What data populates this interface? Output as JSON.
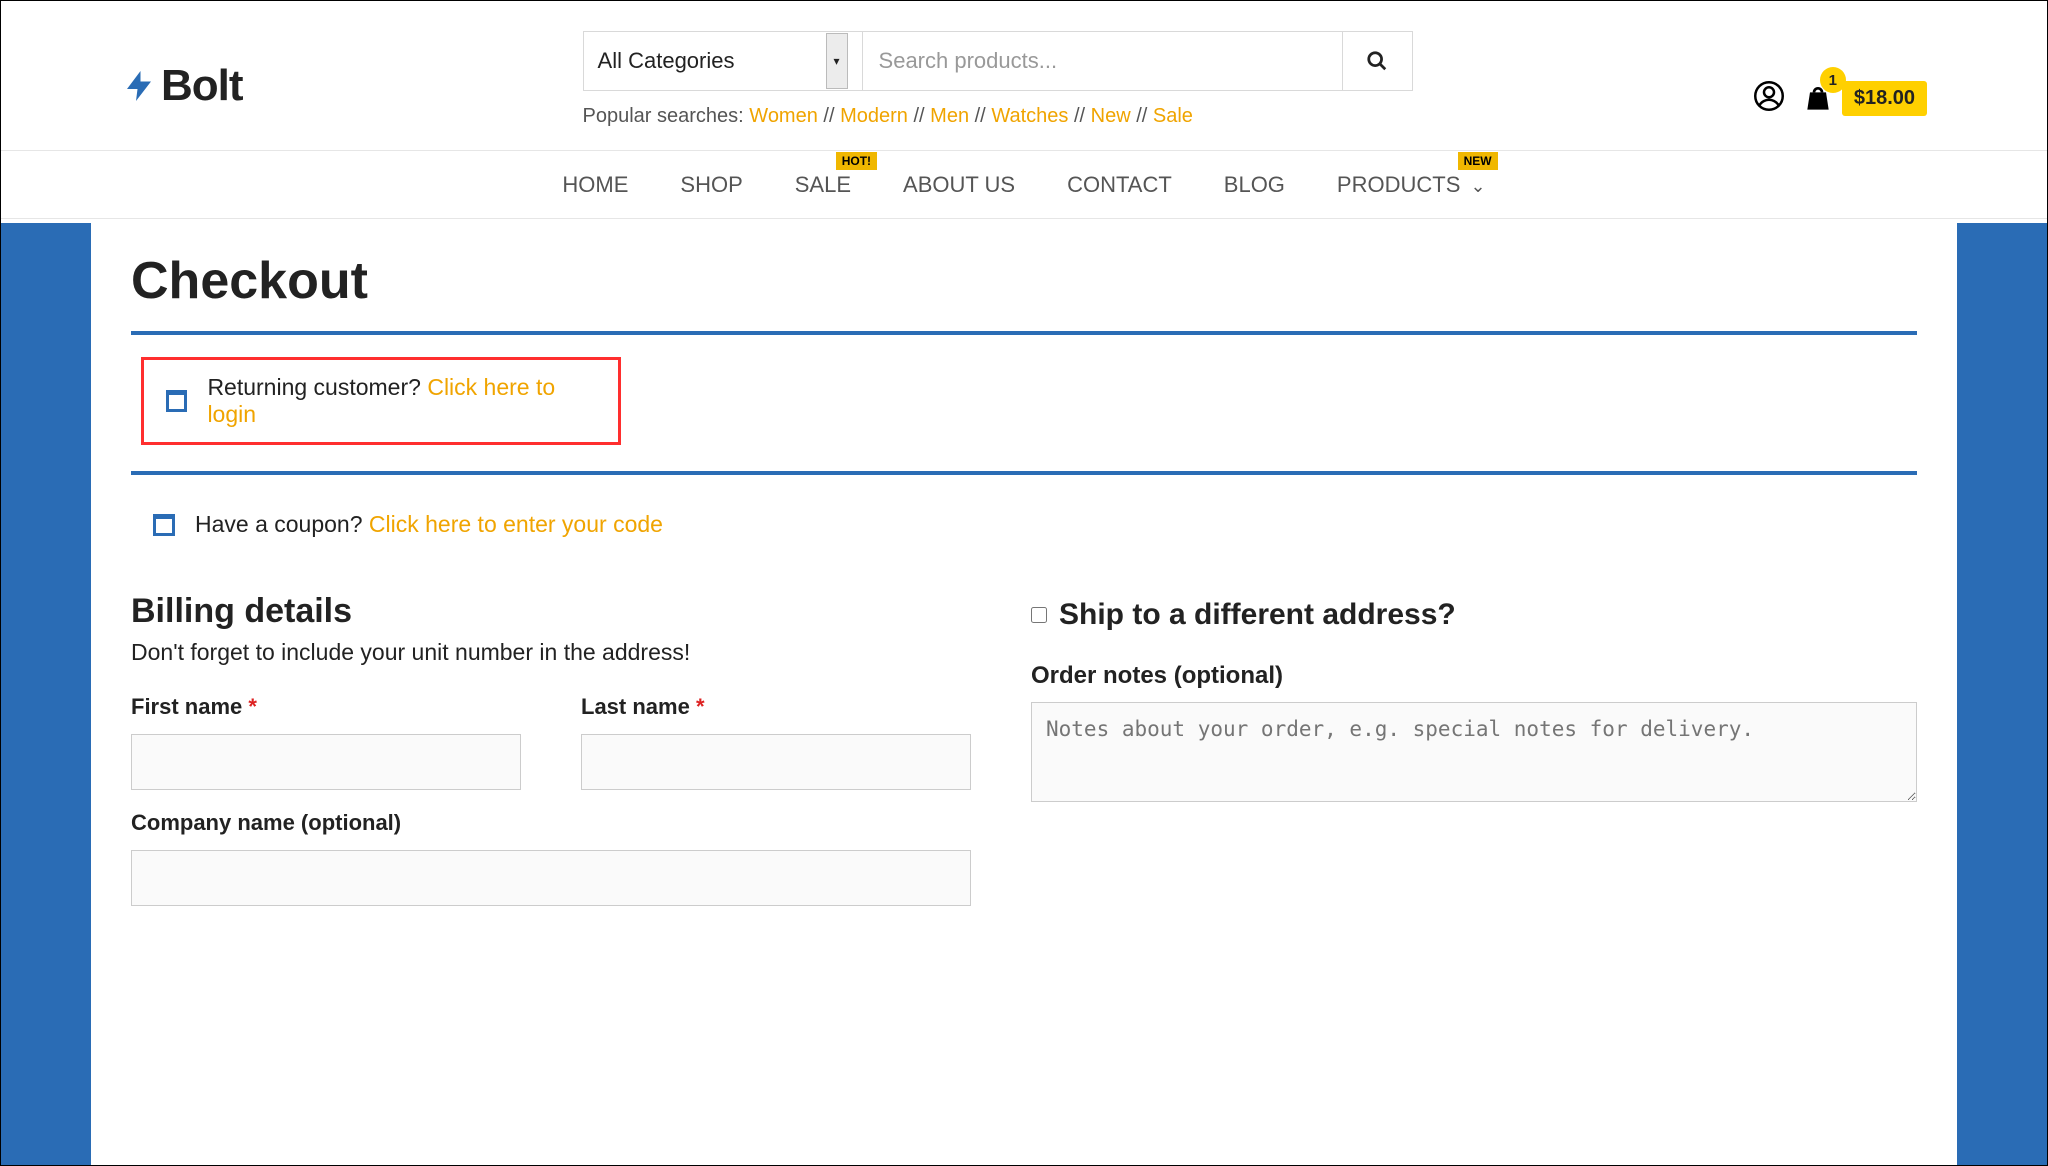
{
  "logo_text": "Bolt",
  "search": {
    "category_label": "All Categories",
    "placeholder": "Search products...",
    "popular_label": "Popular searches:",
    "popular_terms": [
      "Women",
      "Modern",
      "Men",
      "Watches",
      "New",
      "Sale"
    ]
  },
  "cart": {
    "count": "1",
    "price": "$18.00"
  },
  "nav": {
    "home": "HOME",
    "shop": "SHOP",
    "sale": "SALE",
    "sale_badge": "HOT!",
    "about": "ABOUT US",
    "contact": "CONTACT",
    "blog": "BLOG",
    "products": "PRODUCTS",
    "products_badge": "NEW"
  },
  "page_title": "Checkout",
  "returning": {
    "text": "Returning customer?",
    "link": "Click here to login"
  },
  "coupon": {
    "text": "Have a coupon?",
    "link": "Click here to enter your code"
  },
  "billing": {
    "title": "Billing details",
    "note": "Don't forget to include your unit number in the address!",
    "first_name": "First name",
    "last_name": "Last name",
    "company": "Company name (optional)"
  },
  "shipping": {
    "title": "Ship to a different address?",
    "notes_label": "Order notes (optional)",
    "notes_placeholder": "Notes about your order, e.g. special notes for delivery."
  }
}
